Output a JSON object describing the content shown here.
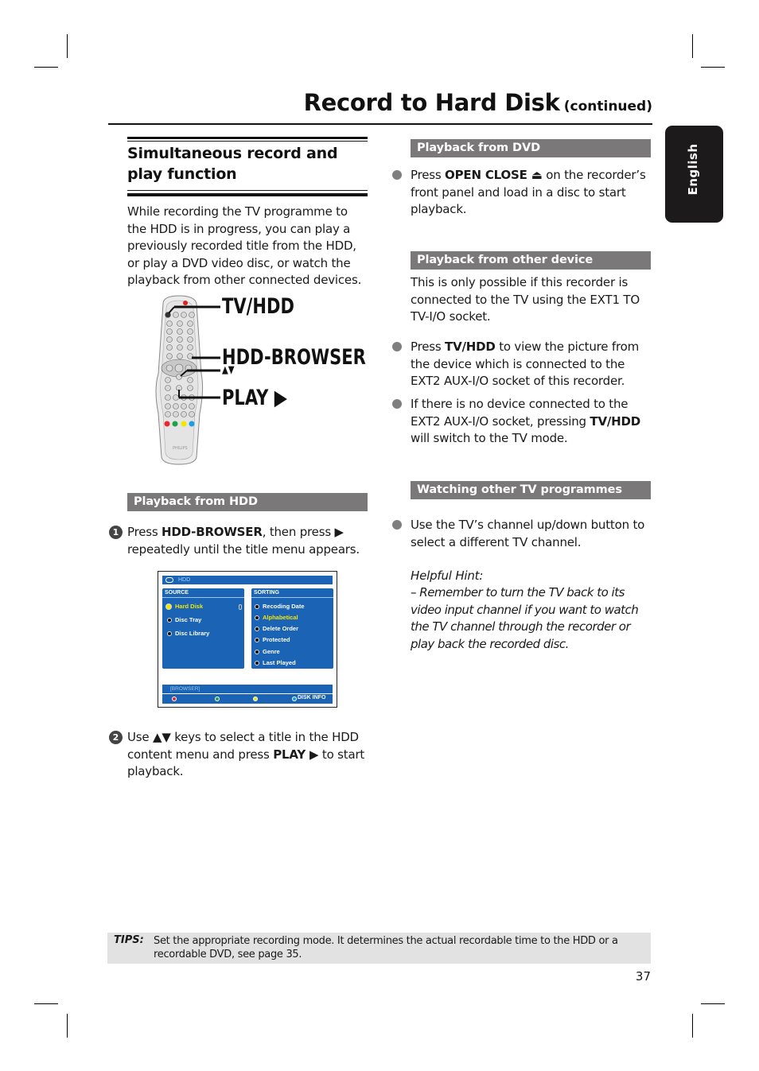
{
  "header": {
    "title": "Record to Hard Disk",
    "continued": "(continued)"
  },
  "language_tab": "English",
  "left": {
    "heading": "Simultaneous record and play function",
    "intro": "While recording the TV programme to the HDD is in progress, you can play a previously recorded title from the HDD, or play a DVD video disc, or watch the playback from other connected devices.",
    "remote_callouts": [
      "TV/HDD",
      "HDD-BROWSER",
      "▲▼",
      "PLAY ▶"
    ],
    "remote_brand": "PHILIPS",
    "playback_hdd": {
      "bar": "Playback from HDD",
      "steps": [
        {
          "num": "1",
          "pre": "Press ",
          "bold": "HDD-BROWSER",
          "post": ", then press ▶ repeatedly until the title menu appears."
        },
        {
          "num": "2",
          "pre": "Use ▲▼ keys to select a title in the HDD content menu and press ",
          "bold": "PLAY ▶",
          "post": " to start playback."
        }
      ]
    },
    "hdd_menu": {
      "top_label": "HDD",
      "source": {
        "header": "SOURCE",
        "items": [
          {
            "label": "Hard Disk",
            "highlighted": true
          },
          {
            "label": "Disc Tray",
            "highlighted": false
          },
          {
            "label": "Disc Library",
            "highlighted": false
          }
        ]
      },
      "sorting": {
        "header": "SORTING",
        "items": [
          {
            "label": "Recoding Date",
            "highlighted": false
          },
          {
            "label": "Alphabetical",
            "highlighted": true
          },
          {
            "label": "Delete Order",
            "highlighted": false
          },
          {
            "label": "Protected",
            "highlighted": false
          },
          {
            "label": "Genre",
            "highlighted": false
          },
          {
            "label": "Last Played",
            "highlighted": false
          }
        ]
      },
      "status": "[BROWSER]",
      "color_keys": {
        "colors": [
          "#e8282b",
          "#1aa34a",
          "#f3e700",
          "#1a9ee0"
        ],
        "blue_label": "DISK INFO"
      }
    }
  },
  "right": {
    "dvd": {
      "bar": "Playback from DVD",
      "pre": "Press ",
      "bold": "OPEN CLOSE ⏏",
      "post": " on the recorder’s front panel and load in a disc to start playback."
    },
    "other_device": {
      "bar": "Playback from other device",
      "intro": "This is only possible if this recorder is connected to the TV using the EXT1 TO TV-I/O socket.",
      "bullets": [
        {
          "pre": "Press ",
          "bold": "TV/HDD",
          "post": " to view the picture from the device which is connected to the EXT2 AUX-I/O socket of this recorder."
        },
        {
          "pre": "If there is no device connected to the EXT2 AUX-I/O socket, pressing ",
          "bold": "TV/HDD",
          "post": " will switch to the TV mode."
        }
      ]
    },
    "watching": {
      "bar": "Watching other TV programmes",
      "bullet": "Use the TV’s channel up/down button to select a different TV channel.",
      "hint_title": "Helpful Hint:",
      "hint": "– Remember to turn the TV back to its video input channel if you want to watch the TV channel through the recorder or play back the recorded disc."
    }
  },
  "tips": {
    "label": "TIPS:",
    "text": "Set the appropriate recording mode. It determines the actual recordable time to the HDD or a recordable DVD, see page 35."
  },
  "page_number": "37",
  "colors": {
    "bar_gray": "#7a7879",
    "menu_blue": "#1a63b5",
    "highlight_yellow": "#f3e700",
    "tips_bg": "#e2e2e2",
    "tab_black": "#1c1a1b"
  }
}
